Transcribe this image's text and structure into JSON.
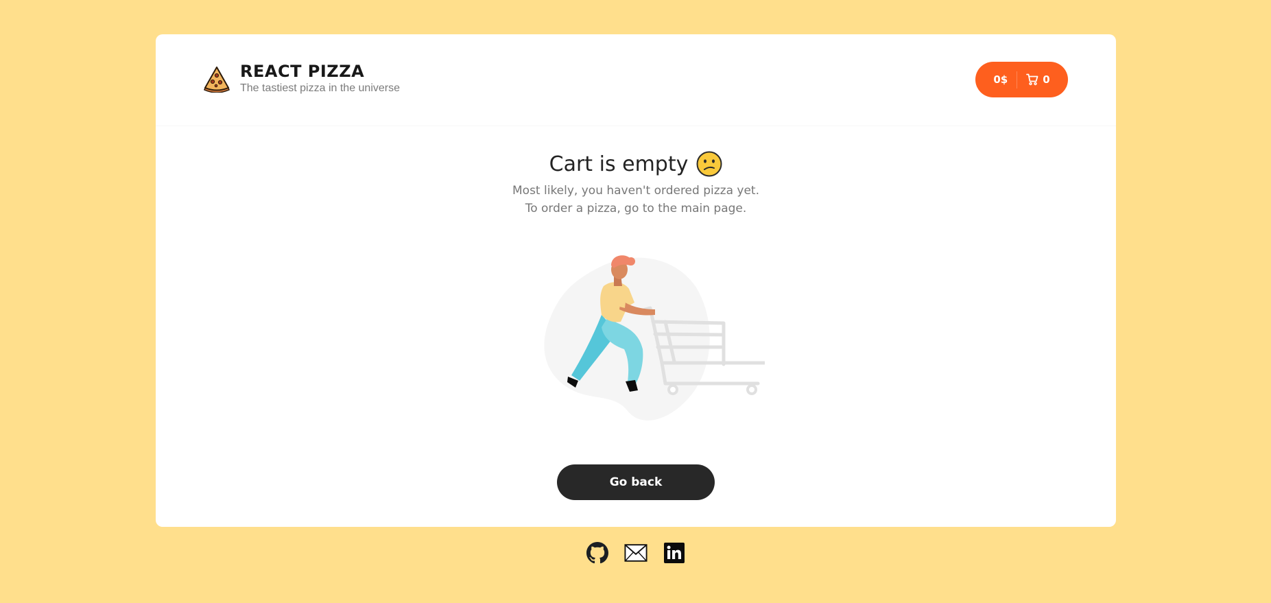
{
  "header": {
    "logo_title": "REACT PIZZA",
    "logo_subtitle": "The tastiest pizza in the universe",
    "logo_icon": "pizza-slice-icon"
  },
  "cart_button": {
    "price": "0$",
    "count": "0",
    "icon": "cart-icon",
    "color": "#fe5f1e"
  },
  "empty_cart": {
    "title": "Cart is empty",
    "emoji": "confused-face-emoji",
    "line1": "Most likely, you haven't ordered pizza yet.",
    "line2": "To order a pizza, go to the main page.",
    "illustration": "person-pushing-cart-illustration",
    "button_label": "Go back"
  },
  "footer": {
    "links": [
      {
        "icon": "github-icon"
      },
      {
        "icon": "mail-icon"
      },
      {
        "icon": "linkedin-icon"
      }
    ]
  },
  "colors": {
    "background": "#ffdf8c",
    "accent": "#fe5f1e",
    "dark_button": "#282828"
  }
}
